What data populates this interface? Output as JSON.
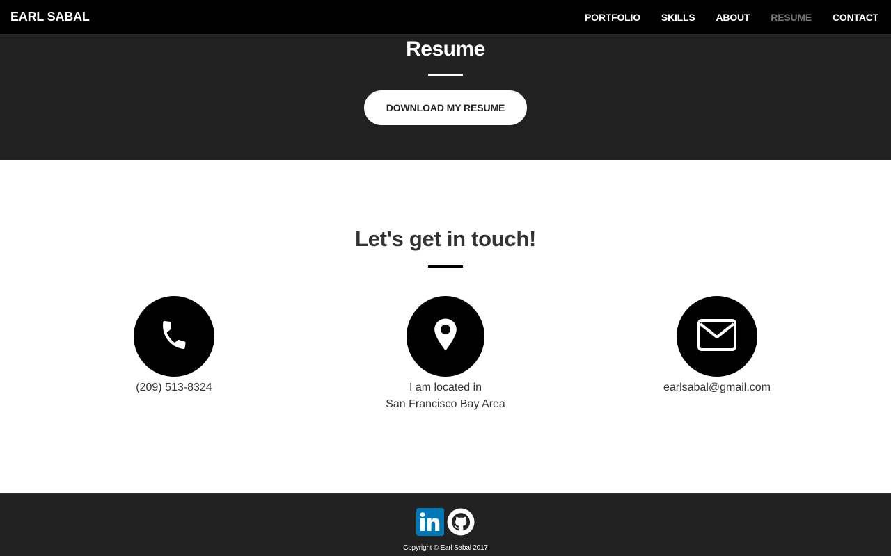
{
  "nav": {
    "brand": "EARL SABAL",
    "links": [
      {
        "label": "PORTFOLIO"
      },
      {
        "label": "SKILLS"
      },
      {
        "label": "ABOUT"
      },
      {
        "label": "RESUME",
        "active": true
      },
      {
        "label": "CONTACT"
      }
    ]
  },
  "resume": {
    "title": "Resume",
    "button_label": "DOWNLOAD MY RESUME"
  },
  "contact": {
    "title": "Let's get in touch!",
    "phone": {
      "icon": "phone-icon",
      "text": "(209) 513-8324"
    },
    "location": {
      "icon": "map-pin-icon",
      "line1": "I am located in",
      "line2": "San Francisco Bay Area"
    },
    "email": {
      "icon": "envelope-icon",
      "text": "earlsabal@gmail.com"
    }
  },
  "footer": {
    "social": [
      {
        "icon": "linkedin-icon",
        "color": "#0077b5"
      },
      {
        "icon": "github-icon",
        "color": "#ffffff"
      }
    ],
    "copyright": "Copyright © Earl Sabal 2017"
  },
  "colors": {
    "navbar_bg": "#000000",
    "section_dark_bg": "#222222",
    "active_nav": "#777777",
    "linkedin_blue": "#0077b5"
  }
}
